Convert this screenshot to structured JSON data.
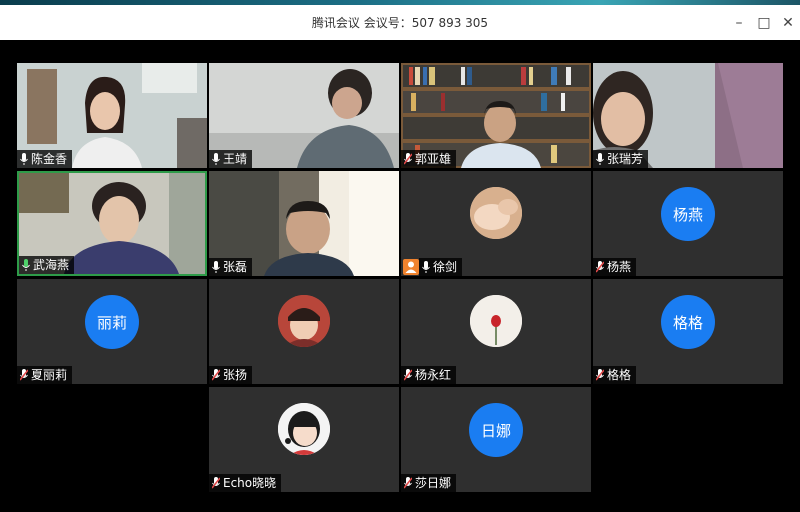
{
  "window": {
    "title": "腾讯会议 会议号：507 893 305",
    "minimize_glyph": "–",
    "maximize_glyph": "□",
    "close_glyph": "✕"
  },
  "colors": {
    "avatar_blue": "#1a7df2",
    "active_border": "#2e9b49",
    "mic_on": "#ffffff",
    "mic_off": "#e24a4a"
  },
  "participants": [
    {
      "name": "陈金香",
      "mic": "on",
      "kind": "video"
    },
    {
      "name": "王靖",
      "mic": "on",
      "kind": "video"
    },
    {
      "name": "郭亚雄",
      "mic": "off",
      "kind": "video"
    },
    {
      "name": "张瑞芳",
      "mic": "on",
      "kind": "video"
    },
    {
      "name": "武海燕",
      "mic": "speaking",
      "kind": "video"
    },
    {
      "name": "张磊",
      "mic": "on",
      "kind": "video"
    },
    {
      "name": "徐剑",
      "mic": "on",
      "kind": "photo",
      "host": true
    },
    {
      "name": "杨燕",
      "mic": "off",
      "kind": "avatar",
      "avatar_text": "杨燕"
    },
    {
      "name": "夏丽莉",
      "mic": "off",
      "kind": "avatar",
      "avatar_text": "丽莉"
    },
    {
      "name": "张扬",
      "mic": "off",
      "kind": "photo"
    },
    {
      "name": "杨永红",
      "mic": "off",
      "kind": "photo"
    },
    {
      "name": "格格",
      "mic": "off",
      "kind": "avatar",
      "avatar_text": "格格"
    },
    {
      "name": "Echo晓晓",
      "mic": "off",
      "kind": "photo"
    },
    {
      "name": "莎日娜",
      "mic": "off",
      "kind": "avatar",
      "avatar_text": "日娜"
    }
  ]
}
